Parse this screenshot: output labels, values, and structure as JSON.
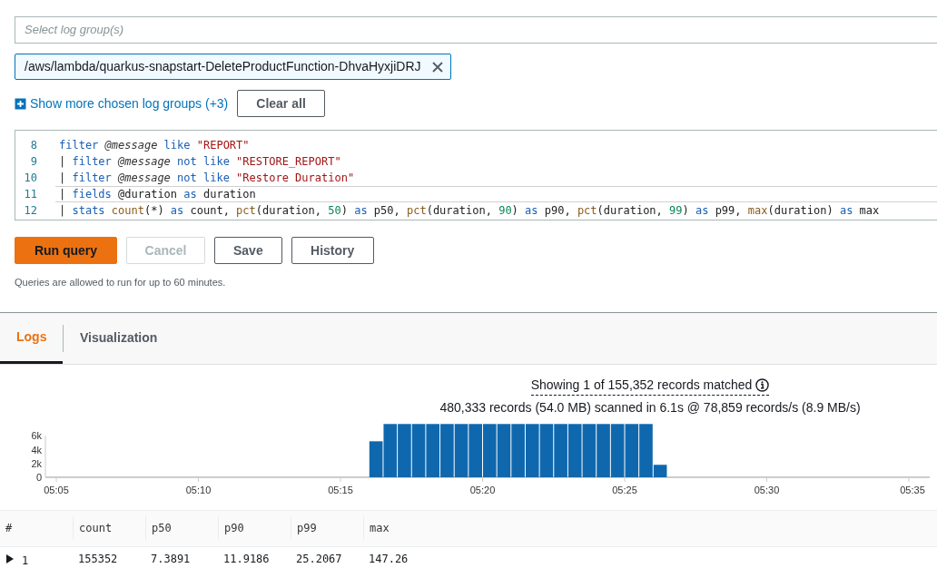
{
  "log_group_select": {
    "placeholder": "Select log group(s)"
  },
  "chosen_groups": [
    {
      "name": "/aws/lambda/quarkus-snapstart-DeleteProductFunction-DhvaHyxjiDRJ"
    }
  ],
  "show_more_link": "Show more chosen log groups (+3)",
  "clear_all_button": "Clear all",
  "editor": {
    "lines": [
      {
        "number": "8",
        "active": false,
        "tokens": [
          {
            "kind": "keyword",
            "text": "filter "
          },
          {
            "kind": "field",
            "text": "@message "
          },
          {
            "kind": "keyword",
            "text": "like "
          },
          {
            "kind": "string",
            "text": "\"REPORT\""
          }
        ]
      },
      {
        "number": "9",
        "active": false,
        "tokens": [
          {
            "kind": "plain",
            "text": "| "
          },
          {
            "kind": "keyword",
            "text": "filter "
          },
          {
            "kind": "field",
            "text": "@message "
          },
          {
            "kind": "keyword",
            "text": "not like "
          },
          {
            "kind": "string",
            "text": "\"RESTORE_REPORT\""
          }
        ]
      },
      {
        "number": "10",
        "active": false,
        "tokens": [
          {
            "kind": "plain",
            "text": "| "
          },
          {
            "kind": "keyword",
            "text": "filter "
          },
          {
            "kind": "field",
            "text": "@message "
          },
          {
            "kind": "keyword",
            "text": "not like "
          },
          {
            "kind": "string",
            "text": "\"Restore Duration\""
          }
        ]
      },
      {
        "number": "11",
        "active": true,
        "tokens": [
          {
            "kind": "plain",
            "text": "| "
          },
          {
            "kind": "keyword",
            "text": "fields"
          },
          {
            "kind": "plain",
            "text": " @duration "
          },
          {
            "kind": "keyword",
            "text": "as"
          },
          {
            "kind": "plain",
            "text": " duration"
          }
        ]
      },
      {
        "number": "12",
        "active": false,
        "tokens": [
          {
            "kind": "plain",
            "text": "| "
          },
          {
            "kind": "keyword",
            "text": "stats "
          },
          {
            "kind": "function",
            "text": "count"
          },
          {
            "kind": "plain",
            "text": "(*) "
          },
          {
            "kind": "keyword",
            "text": "as"
          },
          {
            "kind": "plain",
            "text": " count, "
          },
          {
            "kind": "function",
            "text": "pct"
          },
          {
            "kind": "plain",
            "text": "(duration, "
          },
          {
            "kind": "number",
            "text": "50"
          },
          {
            "kind": "plain",
            "text": ") "
          },
          {
            "kind": "keyword",
            "text": "as"
          },
          {
            "kind": "plain",
            "text": " p50, "
          },
          {
            "kind": "function",
            "text": "pct"
          },
          {
            "kind": "plain",
            "text": "(duration, "
          },
          {
            "kind": "number",
            "text": "90"
          },
          {
            "kind": "plain",
            "text": ") "
          },
          {
            "kind": "keyword",
            "text": "as"
          },
          {
            "kind": "plain",
            "text": " p90, "
          },
          {
            "kind": "function",
            "text": "pct"
          },
          {
            "kind": "plain",
            "text": "(duration, "
          },
          {
            "kind": "number",
            "text": "99"
          },
          {
            "kind": "plain",
            "text": ") "
          },
          {
            "kind": "keyword",
            "text": "as"
          },
          {
            "kind": "plain",
            "text": " p99, "
          },
          {
            "kind": "function",
            "text": "max"
          },
          {
            "kind": "plain",
            "text": "(duration) "
          },
          {
            "kind": "keyword",
            "text": "as"
          },
          {
            "kind": "plain",
            "text": " max"
          }
        ]
      }
    ]
  },
  "actions": [
    {
      "label": "Run query",
      "kind": "primary",
      "disabled": false
    },
    {
      "label": "Cancel",
      "kind": "normal",
      "disabled": true
    },
    {
      "label": "Save",
      "kind": "normal",
      "disabled": false
    },
    {
      "label": "History",
      "kind": "normal",
      "disabled": false
    }
  ],
  "note": "Queries are allowed to run for up to 60 minutes.",
  "tabs": [
    {
      "label": "Logs",
      "selected": true
    },
    {
      "label": "Visualization",
      "selected": false
    }
  ],
  "summary": {
    "matched": "Showing 1 of 155,352 records matched",
    "scanned": "480,333 records (54.0 MB) scanned in 6.1s @ 78,859 records/s (8.9 MB/s)"
  },
  "histogram": {
    "chart_data": {
      "type": "bar",
      "categories": [
        "05:05",
        null,
        null,
        null,
        null,
        null,
        null,
        null,
        null,
        null,
        "05:10",
        null,
        null,
        null,
        null,
        null,
        null,
        null,
        null,
        null,
        "05:15",
        null,
        null,
        null,
        null,
        null,
        null,
        null,
        null,
        null,
        "05:20",
        null,
        null,
        null,
        null,
        null,
        null,
        null,
        null,
        null,
        "05:25",
        null,
        null,
        null,
        null,
        null,
        null,
        null,
        null,
        null,
        "05:30",
        null,
        null,
        null,
        null,
        null,
        null,
        null,
        null,
        null,
        "05:35"
      ],
      "values": [
        null,
        null,
        null,
        null,
        null,
        null,
        null,
        null,
        null,
        null,
        null,
        null,
        null,
        null,
        null,
        null,
        null,
        null,
        null,
        null,
        null,
        null,
        5200,
        7700,
        7700,
        7700,
        7700,
        7700,
        7700,
        7700,
        7700,
        7700,
        7700,
        7700,
        7700,
        7700,
        7700,
        7700,
        7700,
        7700,
        7700,
        7700,
        1800,
        null,
        null,
        null,
        null,
        null,
        null,
        null,
        null,
        null,
        null,
        null,
        null,
        null,
        null,
        null,
        null,
        null,
        null
      ],
      "ylim": [
        0,
        8000
      ],
      "yticks": [
        {
          "value": 0,
          "label": "0"
        },
        {
          "value": 2000,
          "label": "2k"
        },
        {
          "value": 4000,
          "label": "4k"
        },
        {
          "value": 6000,
          "label": "6k"
        }
      ]
    }
  },
  "results": {
    "columns": [
      "#",
      "count",
      "p50",
      "p90",
      "p99",
      "max"
    ],
    "rows": [
      {
        "expanded": false,
        "cells": [
          "1",
          "155352",
          "7.3891",
          "11.9186",
          "25.2067",
          "147.26"
        ]
      }
    ]
  }
}
